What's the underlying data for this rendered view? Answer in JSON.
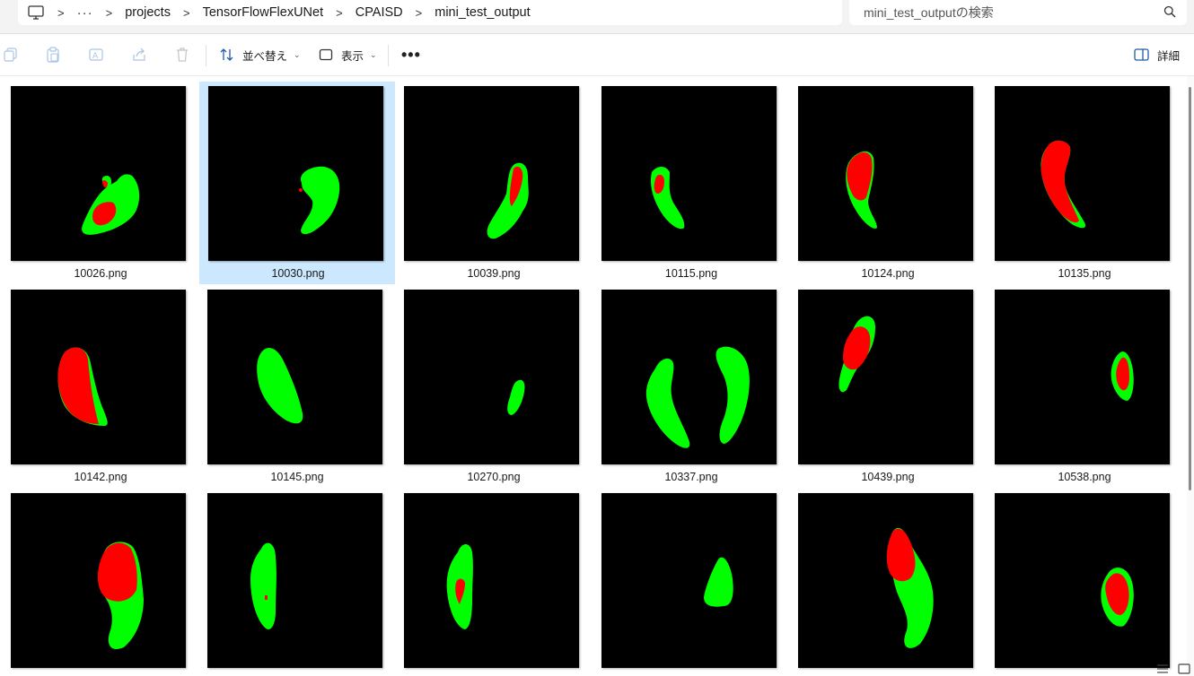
{
  "addressbar": {
    "more_label": "···",
    "crumbs": [
      "projects",
      "TensorFlowFlexUNet",
      "CPAISD",
      "mini_test_output"
    ],
    "separator": ">"
  },
  "search": {
    "placeholder": "mini_test_outputの検索"
  },
  "toolbar": {
    "sort_label": "並べ替え",
    "view_label": "表示",
    "more_label": "•••",
    "details_label": "詳細"
  },
  "files": [
    {
      "name": "10026.png",
      "selected": false
    },
    {
      "name": "10030.png",
      "selected": true
    },
    {
      "name": "10039.png",
      "selected": false
    },
    {
      "name": "10115.png",
      "selected": false
    },
    {
      "name": "10124.png",
      "selected": false
    },
    {
      "name": "10135.png",
      "selected": false
    },
    {
      "name": "10142.png",
      "selected": false
    },
    {
      "name": "10145.png",
      "selected": false
    },
    {
      "name": "10270.png",
      "selected": false
    },
    {
      "name": "10337.png",
      "selected": false
    },
    {
      "name": "10439.png",
      "selected": false
    },
    {
      "name": "10538.png",
      "selected": false
    }
  ],
  "colors": {
    "selection": "#cce8ff",
    "mask_green": "#00ff00",
    "mask_red": "#ff0000",
    "thumb_bg": "#000000"
  }
}
